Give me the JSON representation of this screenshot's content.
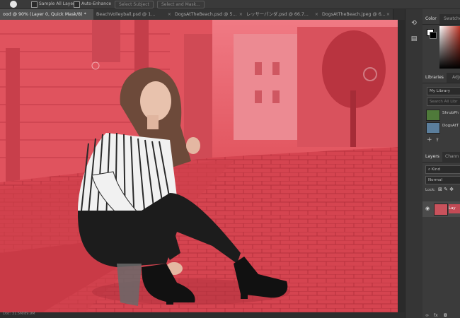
{
  "options_bar": {
    "sample_all_layers": "Sample All Layers",
    "auto_enhance": "Auto-Enhance",
    "select_subject": "Select Subject",
    "select_and_mask": "Select and Mask..."
  },
  "tabs": [
    {
      "label": "ood @ 90% (Layer 0, Quick Mask/8) *",
      "active": true
    },
    {
      "label": "BeachVolleyball.psd @ 1...",
      "active": false
    },
    {
      "label": "DogsAtTheBeach.psd @ 5...",
      "active": false
    },
    {
      "label": "レッサーパンダ.psd @ 66.7...",
      "active": false
    },
    {
      "label": "DogsAtTheBeach.jpeg @ 6...",
      "active": false
    }
  ],
  "status": {
    "zoom": "Doc: 31.5M/89.9M"
  },
  "panels": {
    "color_tab": "Color",
    "swatches_tab": "Swatche",
    "libraries_tab": "Libraries",
    "adjustments_tab": "Adju",
    "library_select": "My Library",
    "library_search": "Search All Libr",
    "library_items": [
      "ShrubPh",
      "DogsAtT"
    ],
    "layers_tab": "Layers",
    "channels_tab": "Chann",
    "kind_filter": "Kind",
    "blend_mode": "Normal",
    "lock_label": "Lock:",
    "layer_name": "Lay"
  },
  "colors": {
    "mask_overlay": "#d9444f",
    "ui_dark": "#3c3c3c",
    "active_tab": "#505050"
  },
  "icons": [
    "brush-icon",
    "checkbox-icon",
    "lasso-icon",
    "eye-icon",
    "lock-icon",
    "link-icon",
    "fx-icon",
    "trash-icon"
  ]
}
